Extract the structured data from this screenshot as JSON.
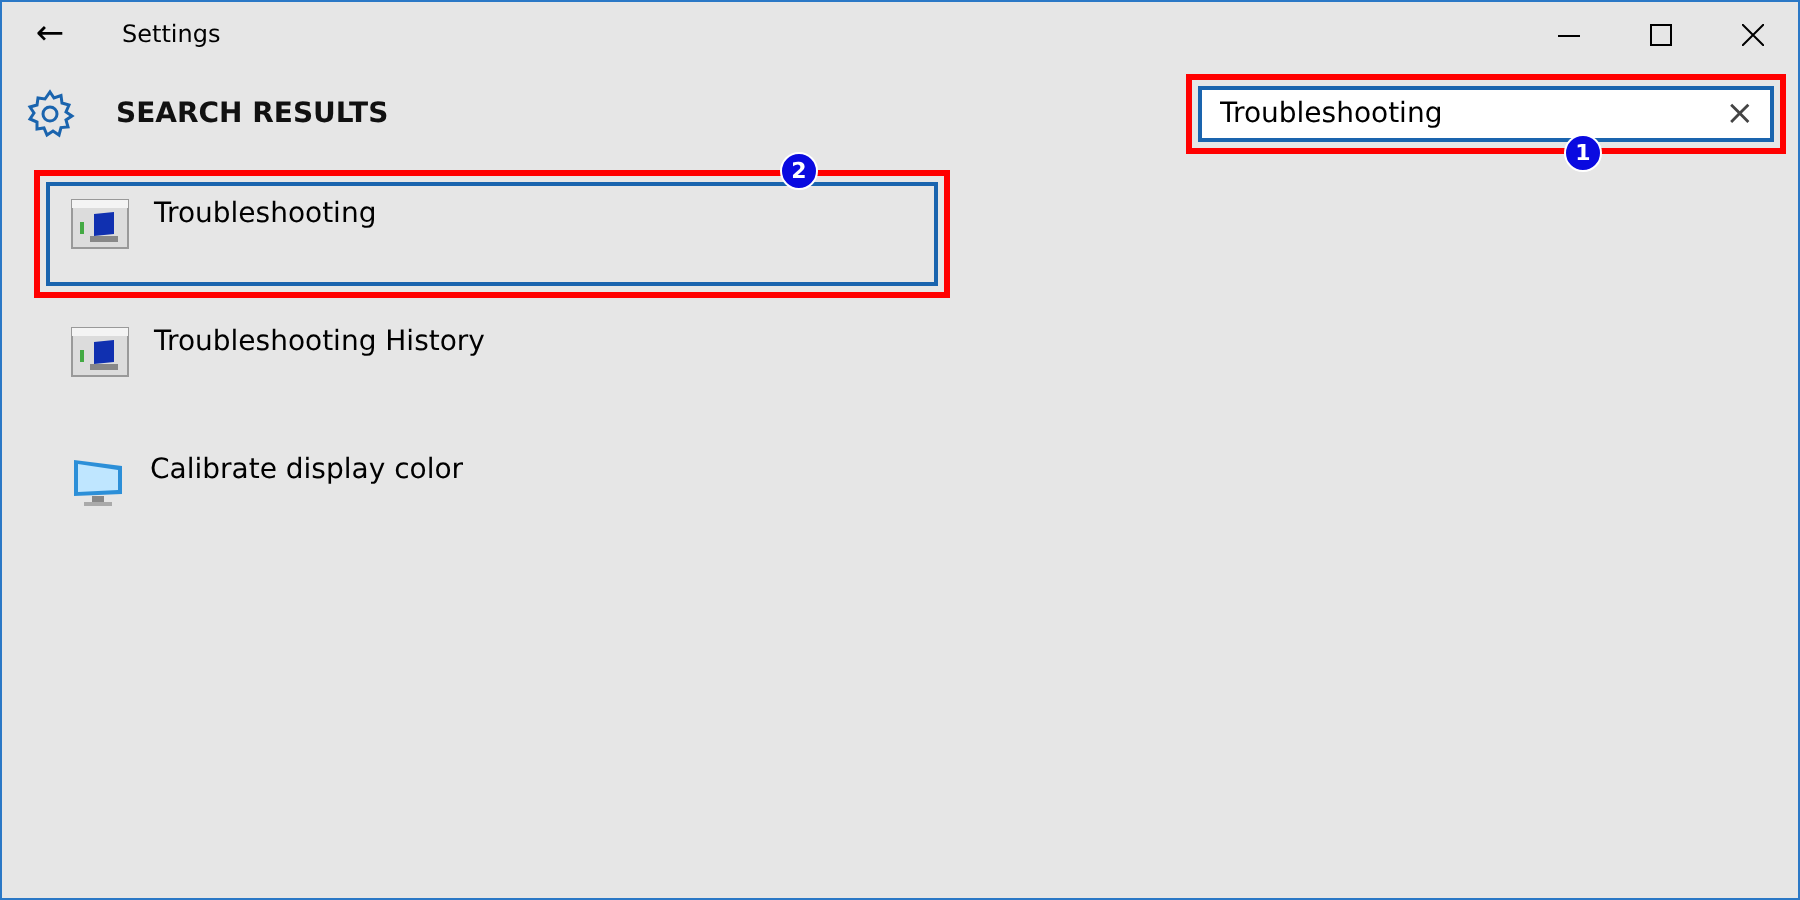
{
  "window": {
    "title": "Settings",
    "back": "←"
  },
  "header": {
    "title": "SEARCH RESULTS"
  },
  "search": {
    "value": "Troubleshooting",
    "clear": "×",
    "callout": "1"
  },
  "results": [
    {
      "label": "Troubleshooting",
      "kind": "troubleshoot",
      "selected": true,
      "callout": "2"
    },
    {
      "label": "Troubleshooting History",
      "kind": "troubleshoot",
      "selected": false
    },
    {
      "label": "Calibrate display color",
      "kind": "display",
      "selected": false
    }
  ]
}
